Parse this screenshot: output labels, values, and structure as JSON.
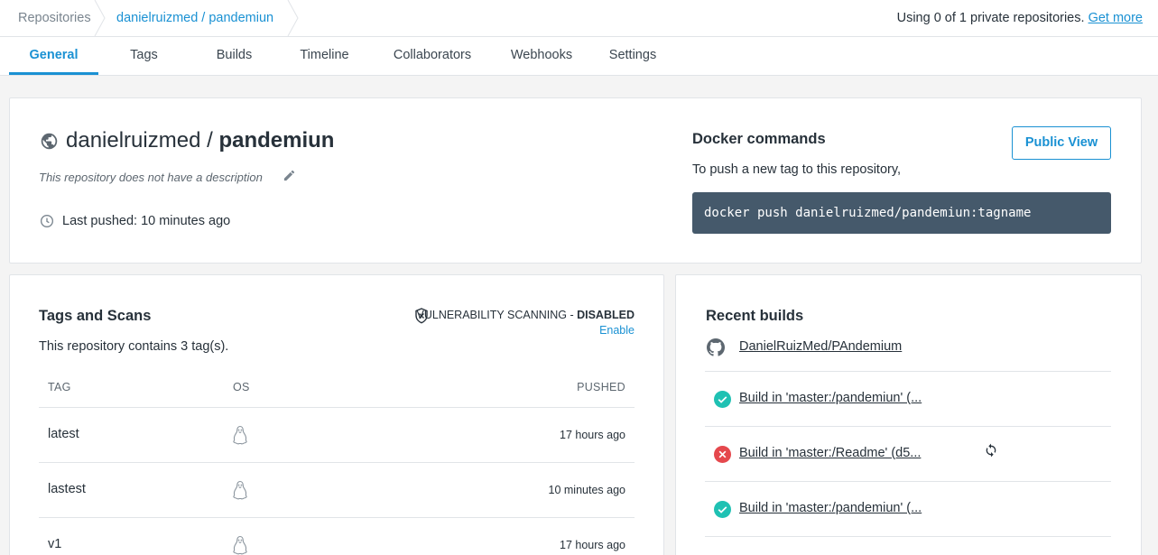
{
  "breadcrumb": {
    "root": "Repositories",
    "current": "danielruizmed / pandemiun"
  },
  "usage": {
    "text": "Using 0 of 1 private repositories.",
    "link": "Get more"
  },
  "tabs": [
    {
      "label": "General",
      "active": true
    },
    {
      "label": "Tags",
      "active": false
    },
    {
      "label": "Builds",
      "active": false
    },
    {
      "label": "Timeline",
      "active": false
    },
    {
      "label": "Collaborators",
      "active": false
    },
    {
      "label": "Webhooks",
      "active": false
    },
    {
      "label": "Settings",
      "active": false
    }
  ],
  "repo": {
    "namespace": "danielruizmed",
    "separator": "/",
    "name": "pandemiun",
    "description": "This repository does not have a description",
    "last_pushed": "Last pushed: 10 minutes ago",
    "visibility_icon": "globe-icon"
  },
  "docker": {
    "title": "Docker commands",
    "subtitle": "To push a new tag to this repository,",
    "command": "docker push danielruizmed/pandemiun:tagname",
    "public_view": "Public View"
  },
  "tags_card": {
    "title": "Tags and Scans",
    "vuln_label": "VULNERABILITY SCANNING - ",
    "vuln_status": "DISABLED",
    "enable": "Enable",
    "contains": "This repository contains 3 tag(s).",
    "columns": {
      "tag": "TAG",
      "os": "OS",
      "pushed": "PUSHED"
    },
    "rows": [
      {
        "tag": "latest",
        "os": "linux-icon",
        "pushed": "17 hours ago"
      },
      {
        "tag": "lastest",
        "os": "linux-icon",
        "pushed": "10 minutes ago"
      },
      {
        "tag": "v1",
        "os": "linux-icon",
        "pushed": "17 hours ago"
      }
    ]
  },
  "builds_card": {
    "title": "Recent builds",
    "source": "DanielRuizMed/PAndemium",
    "builds": [
      {
        "label": "Build in 'master:/pandemiun' (...",
        "status": "success"
      },
      {
        "label": "Build in 'master:/Readme' (d5...",
        "status": "failed"
      },
      {
        "label": "Build in 'master:/pandemiun' (...",
        "status": "success"
      }
    ]
  },
  "colors": {
    "accent": "#1a91d3",
    "success": "#1fc1b3",
    "failed": "#e5484d",
    "command_bg": "#45596b"
  }
}
